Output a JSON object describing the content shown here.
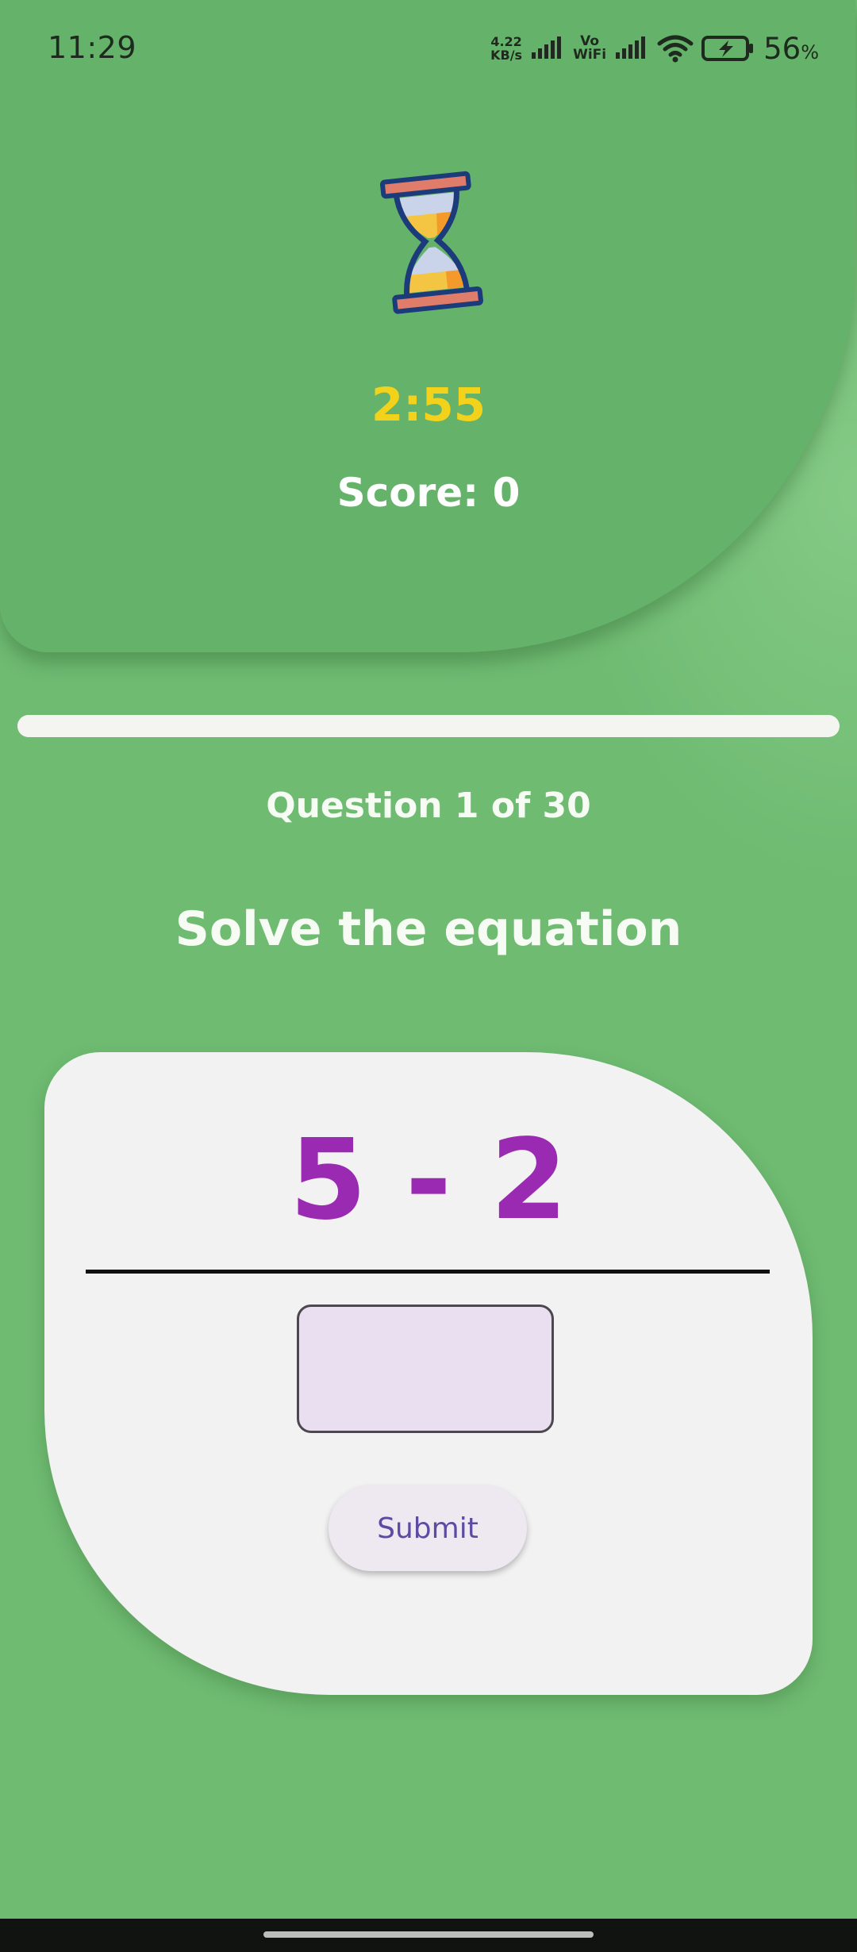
{
  "status_bar": {
    "time": "11:29",
    "net_speed_value": "4.22",
    "net_speed_unit": "KB/s",
    "vowifi_top": "Vo",
    "vowifi_bottom": "WiFi",
    "battery_percent": "56",
    "battery_unit": "%"
  },
  "header": {
    "timer": "2:55",
    "score": "Score: 0"
  },
  "progress": {
    "fraction": 0.033
  },
  "quiz": {
    "question_counter": "Question 1 of 30",
    "instruction": "Solve the equation",
    "equation": "5 - 2",
    "answer_value": "",
    "submit_label": "Submit"
  },
  "icons": {
    "timer_icon": "hourglass-icon"
  },
  "colors": {
    "background": "#6fbb72",
    "header": "#65b36a",
    "timer": "#f3d21b",
    "equation": "#9a2ab2",
    "submit_text": "#5d4aa2"
  }
}
